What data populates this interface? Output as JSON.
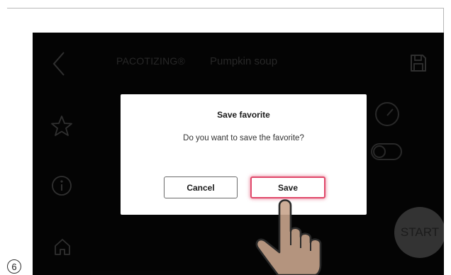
{
  "header": {
    "brand": "PACOTIZING®",
    "title": "Pumpkin soup"
  },
  "start_button": {
    "label": "START"
  },
  "dialog": {
    "title": "Save favorite",
    "message": "Do you want to save the favorite?",
    "cancel_label": "Cancel",
    "save_label": "Save"
  },
  "step_number": "6",
  "colors": {
    "screen_background": "#070707",
    "dialog_background": "#ffffff",
    "save_highlight": "#e0486a",
    "start_button": "#4f4f4f"
  },
  "icons": {
    "back": "chevron-left-icon",
    "save_file": "floppy-disk-icon",
    "favorite": "star-icon",
    "info": "info-icon",
    "home": "home-icon",
    "gauge": "gauge-icon",
    "pointer": "hand-pointer-icon"
  }
}
